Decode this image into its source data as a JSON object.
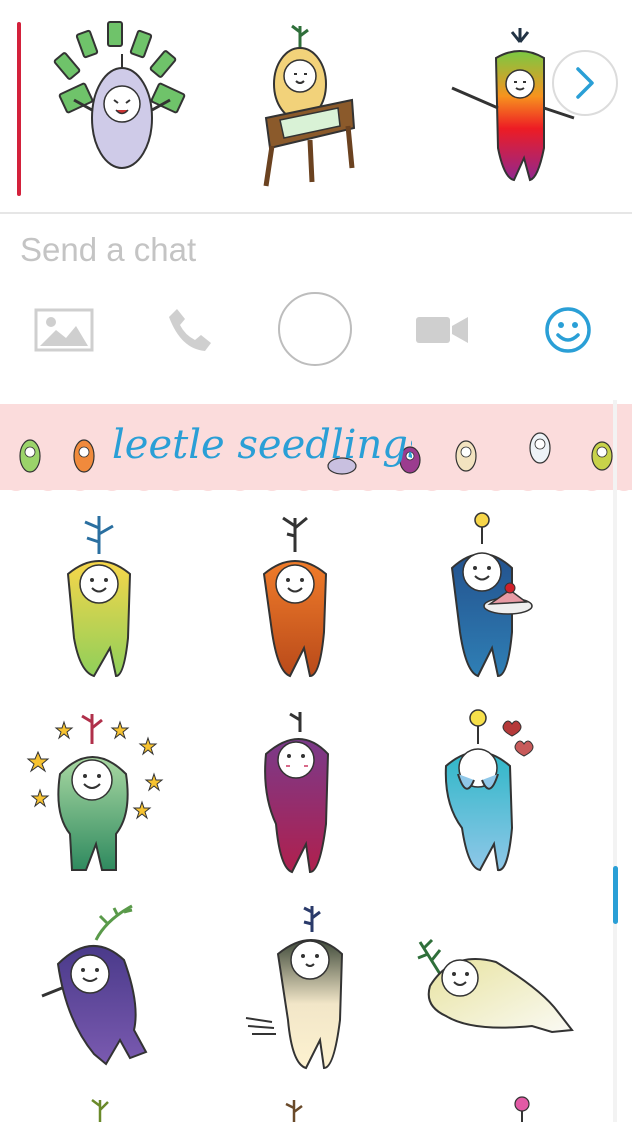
{
  "top_strip": {
    "stickers": [
      "money-rain-sticker",
      "reading-desk-sticker",
      "rainbow-sticker"
    ],
    "next_icon": "chevron-right-icon"
  },
  "chat": {
    "placeholder": "Send a chat"
  },
  "toolbar": {
    "icons": [
      "image-icon",
      "phone-icon",
      "shutter-button",
      "video-camera-icon",
      "smiley-icon"
    ],
    "active_color": "#2a9fd6",
    "inactive_color": "#cfcfcf"
  },
  "pack": {
    "title": "leetle seedlings",
    "banner_color": "#fbdcdc",
    "title_color": "#2a9fd6"
  },
  "grid": {
    "stickers": [
      "yellow-seedling-sticker",
      "orange-seedling-sticker",
      "blue-seedling-cake-sticker",
      "green-seedling-stars-sticker",
      "purple-seedling-blush-sticker",
      "teal-seedling-hearts-sticker",
      "indigo-seedling-waving-sticker",
      "olive-seedling-running-sticker",
      "cream-seedling-lying-sticker"
    ]
  },
  "scroll": {
    "position": 0.65
  }
}
